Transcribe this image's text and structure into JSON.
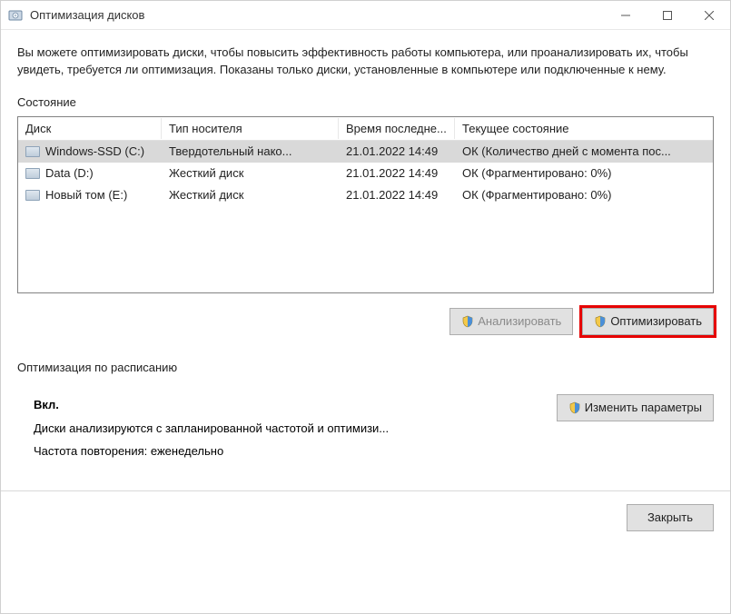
{
  "window": {
    "title": "Оптимизация дисков"
  },
  "intro": "Вы можете оптимизировать диски, чтобы повысить эффективность работы  компьютера, или проанализировать их, чтобы увидеть, требуется ли оптимизация. Показаны только диски, установленные в компьютере или подключенные к нему.",
  "state_label": "Состояние",
  "columns": {
    "disk": "Диск",
    "media": "Тип носителя",
    "last": "Время последне...",
    "status": "Текущее состояние"
  },
  "rows": [
    {
      "name": "Windows-SSD (C:)",
      "media": "Твердотельный нако...",
      "last": "21.01.2022 14:49",
      "status": "ОК (Количество дней с момента пос...",
      "selected": true
    },
    {
      "name": "Data (D:)",
      "media": "Жесткий диск",
      "last": "21.01.2022 14:49",
      "status": "ОК (Фрагментировано: 0%)",
      "selected": false
    },
    {
      "name": "Новый том (E:)",
      "media": "Жесткий диск",
      "last": "21.01.2022 14:49",
      "status": "ОК (Фрагментировано: 0%)",
      "selected": false
    }
  ],
  "buttons": {
    "analyze": "Анализировать",
    "optimize": "Оптимизировать",
    "change_settings": "Изменить параметры",
    "close": "Закрыть"
  },
  "schedule": {
    "label": "Оптимизация по расписанию",
    "status": "Вкл.",
    "desc": "Диски анализируются с запланированной частотой и оптимизи...",
    "freq": "Частота повторения: еженедельно"
  }
}
